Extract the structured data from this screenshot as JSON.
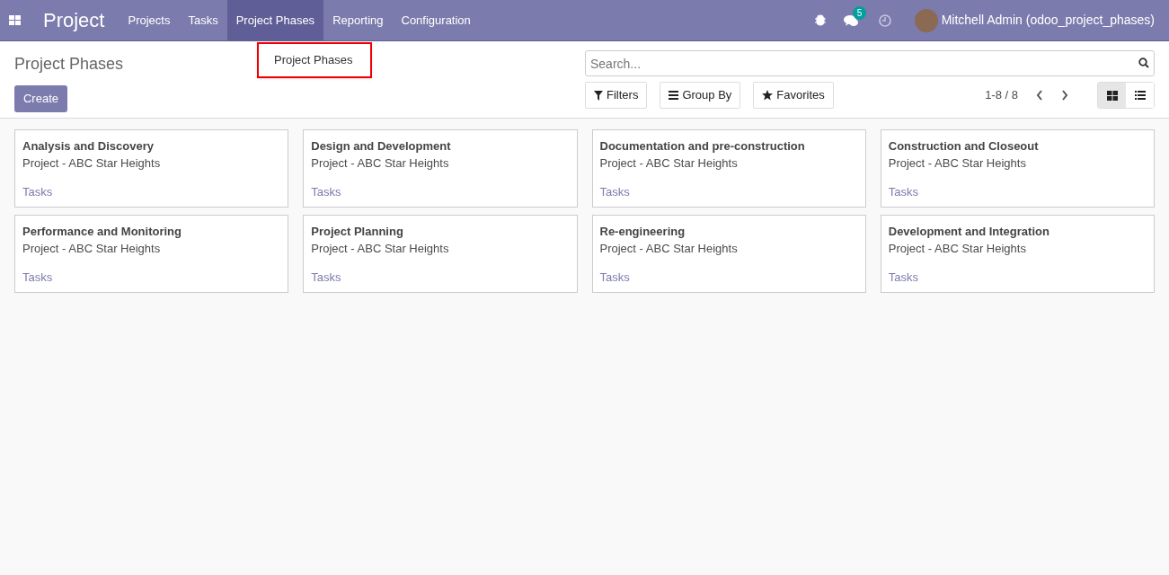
{
  "app_title": "Project",
  "menu": [
    {
      "label": "Projects",
      "selected": false
    },
    {
      "label": "Tasks",
      "selected": false
    },
    {
      "label": "Project Phases",
      "selected": true
    },
    {
      "label": "Reporting",
      "selected": false
    },
    {
      "label": "Configuration",
      "selected": false
    }
  ],
  "dropdown": {
    "items": [
      "Project Phases"
    ]
  },
  "systray": {
    "messages_count": "5",
    "user": "Mitchell Admin (odoo_project_phases)"
  },
  "breadcrumb": "Project Phases",
  "create_button": "Create",
  "search": {
    "placeholder": "Search..."
  },
  "filter_buttons": [
    {
      "kind": "filter",
      "label": "Filters"
    },
    {
      "kind": "groupby",
      "label": "Group By"
    },
    {
      "kind": "favorites",
      "label": "Favorites"
    }
  ],
  "pager": "1-8 / 8",
  "views": [
    {
      "kind": "kanban",
      "selected": true
    },
    {
      "kind": "list",
      "selected": false
    }
  ],
  "cards": [
    {
      "title": "Analysis and Discovery",
      "subtitle": "Project - ABC Star Heights",
      "link": "Tasks"
    },
    {
      "title": "Design and Development",
      "subtitle": "Project - ABC Star Heights",
      "link": "Tasks"
    },
    {
      "title": "Documentation and pre-construction",
      "subtitle": "Project - ABC Star Heights",
      "link": "Tasks"
    },
    {
      "title": "Construction and Closeout",
      "subtitle": "Project - ABC Star Heights",
      "link": "Tasks"
    },
    {
      "title": "Performance and Monitoring",
      "subtitle": "Project - ABC Star Heights",
      "link": "Tasks"
    },
    {
      "title": "Project Planning",
      "subtitle": "Project - ABC Star Heights",
      "link": "Tasks"
    },
    {
      "title": "Re-engineering",
      "subtitle": "Project - ABC Star Heights",
      "link": "Tasks"
    },
    {
      "title": "Development and Integration",
      "subtitle": "Project - ABC Star Heights",
      "link": "Tasks"
    }
  ]
}
